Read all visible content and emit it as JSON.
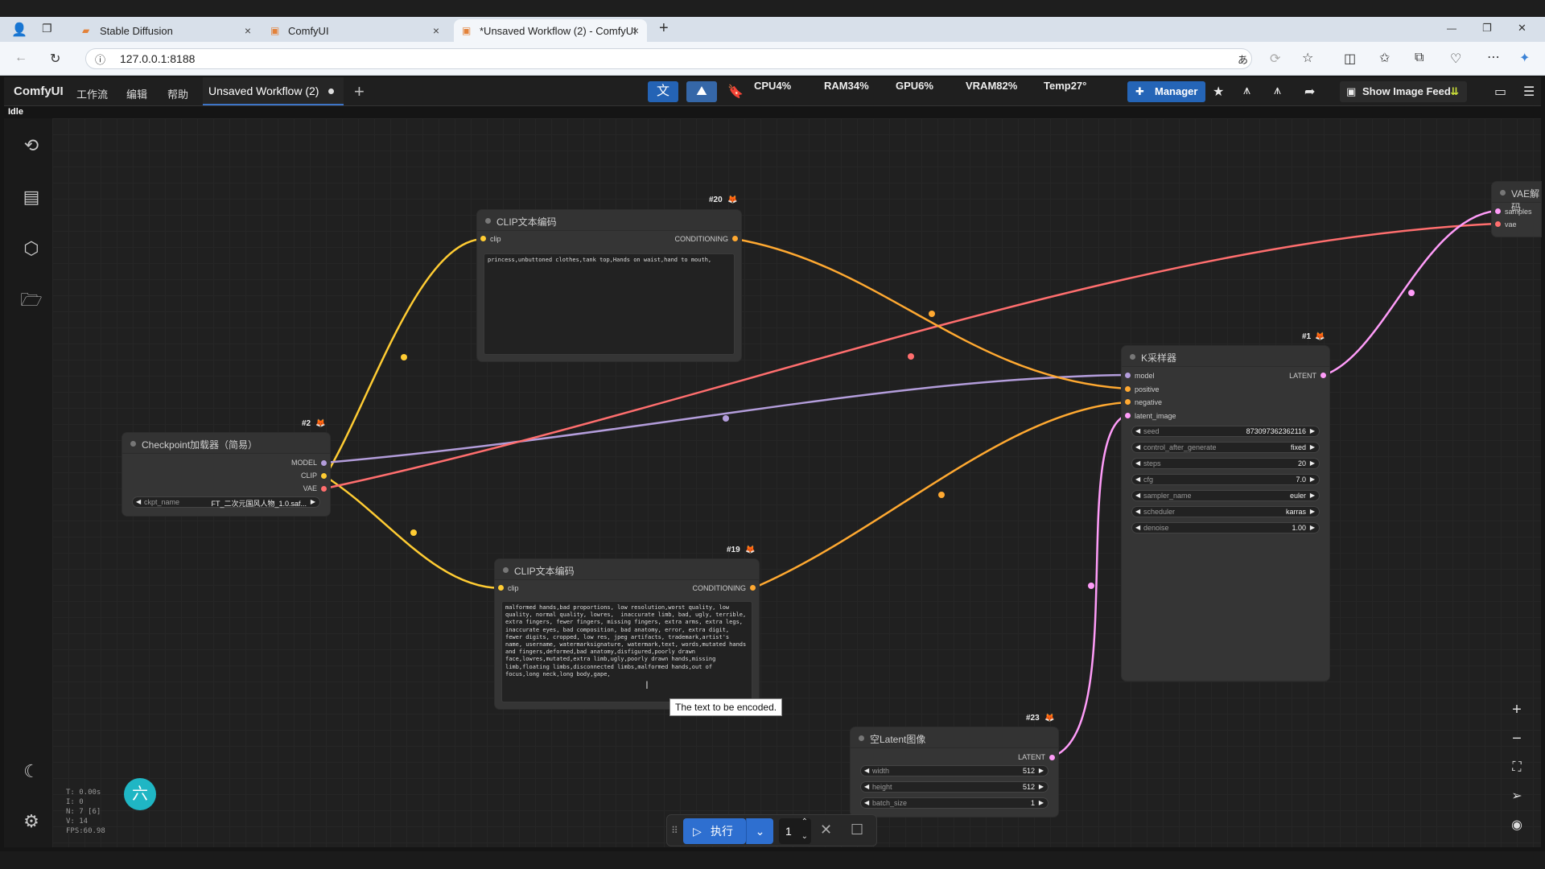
{
  "browser": {
    "tabs": [
      {
        "label": "Stable Diffusion",
        "close": "×"
      },
      {
        "label": "ComfyUI",
        "close": "×"
      },
      {
        "label": "*Unsaved Workflow (2) - ComfyUI",
        "close": "×"
      }
    ],
    "new_tab": "+",
    "url": "127.0.0.1:8188",
    "window_controls": {
      "minimize": "—",
      "restore": "❐",
      "close": "✕"
    }
  },
  "app": {
    "brand": "ComfyUI",
    "menu": [
      "工作流",
      "编辑",
      "帮助"
    ],
    "workflow_tab": "Unsaved Workflow (2)",
    "add_tab": "+",
    "stats": {
      "cpu": "CPU4%",
      "ram": "RAM34%",
      "gpu": "GPU6%",
      "vram": "VRAM82%",
      "temp": "Temp27°"
    },
    "manager": "Manager",
    "show_image_feed": "Show Image Feed",
    "status": "Idle"
  },
  "nodes": {
    "clip_top": {
      "id": "#20",
      "title": "CLIP文本编码",
      "input": "clip",
      "output": "CONDITIONING",
      "text": "princess,unbuttoned clothes,tank top,Hands on waist,hand to mouth,"
    },
    "clip_bottom": {
      "id": "#19",
      "title": "CLIP文本编码",
      "input": "clip",
      "output": "CONDITIONING",
      "text": "malformed hands,bad proportions, low resolution,worst quality, low quality, normal quality, lowres,  inaccurate limb, bad, ugly, terrible,  extra fingers, fewer fingers, missing fingers, extra arms, extra legs, inaccurate eyes, bad composition, bad anatomy, error, extra digit, fewer digits, cropped, low res, jpeg artifacts, trademark,artist's name, username, watermarksignature, watermark,text, words,mutated hands and fingers,deformed,bad anatomy,disfigured,poorly drawn face,lowres,mutated,extra limb,ugly,poorly drawn hands,missing limb,floating limbs,disconnected limbs,malformed hands,out of focus,long neck,long body,gape,"
    },
    "checkpoint": {
      "id": "#2",
      "title": "Checkpoint加载器（简易）",
      "outputs": [
        "MODEL",
        "CLIP",
        "VAE"
      ],
      "widget_label": "ckpt_name",
      "widget_value": "FT_二次元国风人物_1.0.saf..."
    },
    "ksampler": {
      "id": "#1",
      "title": "K采样器",
      "inputs": [
        "model",
        "positive",
        "negative",
        "latent_image"
      ],
      "output": "LATENT",
      "widgets": [
        {
          "label": "seed",
          "value": "873097362362116"
        },
        {
          "label": "control_after_generate",
          "value": "fixed"
        },
        {
          "label": "steps",
          "value": "20"
        },
        {
          "label": "cfg",
          "value": "7.0"
        },
        {
          "label": "sampler_name",
          "value": "euler"
        },
        {
          "label": "scheduler",
          "value": "karras"
        },
        {
          "label": "denoise",
          "value": "1.00"
        }
      ]
    },
    "latent": {
      "id": "#23",
      "title": "空Latent图像",
      "output": "LATENT",
      "widgets": [
        {
          "label": "width",
          "value": "512"
        },
        {
          "label": "height",
          "value": "512"
        },
        {
          "label": "batch_size",
          "value": "1"
        }
      ]
    },
    "vae": {
      "title": "VAE解码",
      "inputs": [
        "samples",
        "vae"
      ]
    }
  },
  "tooltip": "The text to be encoded.",
  "canvas_stats": "T: 0.00s\nI: 0\nN: 7 [6]\nV: 14\nFPS:60.98",
  "avatar": "六",
  "runbar": {
    "run_label": "执行",
    "queue_count": "1"
  },
  "colors": {
    "clip": "#ffcc33",
    "model": "#b39ddb",
    "vae": "#ff6e6e",
    "latent": "#ff9cf9",
    "conditioning": "#ffa931",
    "accent": "#2463b5"
  }
}
